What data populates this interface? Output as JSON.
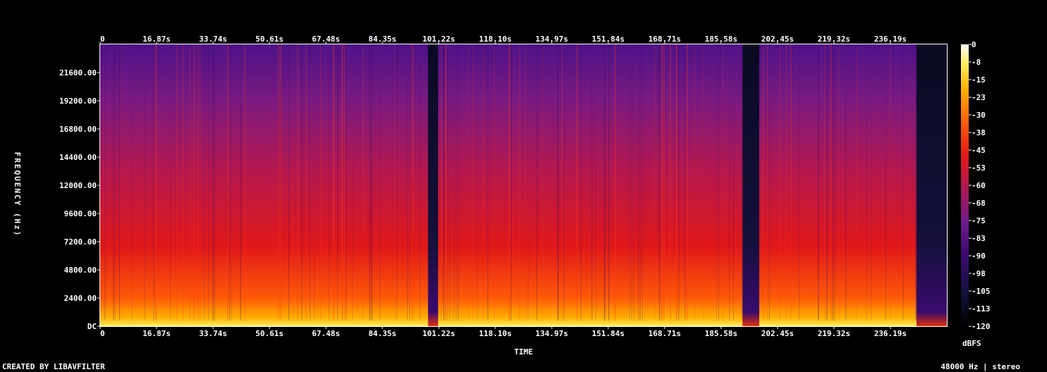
{
  "chart_data": {
    "type": "heatmap",
    "xlabel": "TIME",
    "ylabel": "FREQUENCY (Hz)",
    "colorbar_label": "dBFS",
    "x_ticks": [
      "0",
      "16.87s",
      "33.74s",
      "50.61s",
      "67.48s",
      "84.35s",
      "101.22s",
      "118.10s",
      "134.97s",
      "151.84s",
      "168.71s",
      "185.58s",
      "202.45s",
      "219.32s",
      "236.19s"
    ],
    "x_tick_values": [
      0,
      16.87,
      33.74,
      50.61,
      67.48,
      84.35,
      101.22,
      118.1,
      134.97,
      151.84,
      168.71,
      185.58,
      202.45,
      219.32,
      236.19
    ],
    "xlim": [
      0,
      253.06
    ],
    "y_ticks": [
      "DC",
      "2400.00",
      "4800.00",
      "7200.00",
      "9600.00",
      "12000.00",
      "14400.00",
      "16800.00",
      "19200.00",
      "21600.00"
    ],
    "y_tick_values": [
      0,
      2400,
      4800,
      7200,
      9600,
      12000,
      14400,
      16800,
      19200,
      21600
    ],
    "ylim": [
      0,
      24000
    ],
    "colorbar_ticks": [
      "0",
      "-8",
      "-15",
      "-23",
      "-30",
      "-38",
      "-45",
      "-53",
      "-60",
      "-68",
      "-75",
      "-83",
      "-90",
      "-98",
      "-105",
      "-113",
      "-120"
    ],
    "colorbar_range": [
      -120,
      0
    ],
    "colormap": [
      "#000000",
      "#12123a",
      "#3a0a6e",
      "#6a1a8c",
      "#a8185a",
      "#e01818",
      "#ff5a08",
      "#ffb000",
      "#ffee60",
      "#ffffff"
    ],
    "quiet_segments": [
      [
        98.0,
        101.0
      ],
      [
        192.0,
        197.0
      ],
      [
        244.0,
        253.06
      ]
    ],
    "notes_visible": [
      "CREATED BY LIBAVFILTER",
      "48000 Hz | stereo"
    ]
  },
  "footer": {
    "left": "CREATED BY LIBAVFILTER",
    "right": "48000 Hz | stereo"
  }
}
